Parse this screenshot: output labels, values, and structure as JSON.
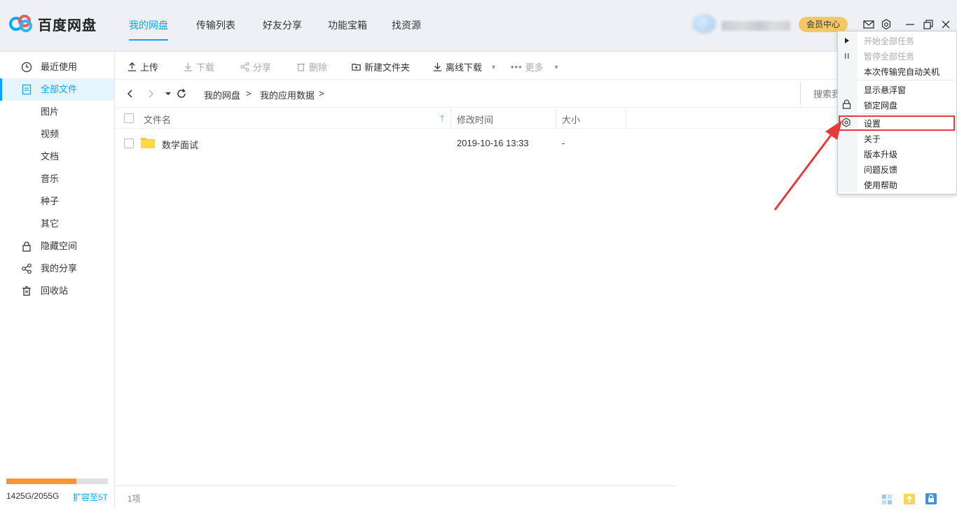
{
  "app": {
    "title": "百度网盘",
    "nav_tabs": [
      "我的网盘",
      "传输列表",
      "好友分享",
      "功能宝箱",
      "找资源"
    ],
    "active_tab": 0,
    "vip_label": "会员中心",
    "colors": {
      "accent": "#06a7ff",
      "vip": "#f5c867",
      "quota": "#f99637",
      "highlight": "#e53a3a"
    }
  },
  "sidebar": {
    "items": [
      {
        "label": "最近使用",
        "icon": "clock-icon"
      },
      {
        "label": "全部文件",
        "icon": "document-icon",
        "active": true
      },
      {
        "label": "图片"
      },
      {
        "label": "视频"
      },
      {
        "label": "文档"
      },
      {
        "label": "音乐"
      },
      {
        "label": "种子"
      },
      {
        "label": "其它"
      },
      {
        "label": "隐藏空间",
        "icon": "lock-icon"
      },
      {
        "label": "我的分享",
        "icon": "share-icon"
      },
      {
        "label": "回收站",
        "icon": "trash-icon"
      }
    ],
    "quota": {
      "text": "1425G/2055G",
      "used_fraction": 0.693,
      "expand_label": "扩容至5T"
    }
  },
  "toolbar": {
    "upload": "上传",
    "download": "下载",
    "share": "分享",
    "delete": "删除",
    "new_folder": "新建文件夹",
    "offline_download": "离线下载",
    "more": "更多"
  },
  "address": {
    "crumbs": [
      "我的网盘",
      "我的应用数据"
    ],
    "separator": ">",
    "search_placeholder": "搜索我"
  },
  "file_list": {
    "columns": {
      "name": "文件名",
      "modified": "修改时间",
      "size": "大小"
    },
    "rows": [
      {
        "name": "数学面试",
        "modified": "2019-10-16 13:33",
        "size": "-",
        "type": "folder"
      }
    ],
    "count_label": "1项"
  },
  "menu": {
    "items": [
      {
        "label": "开始全部任务",
        "disabled": true
      },
      {
        "label": "暂停全部任务",
        "disabled": true
      },
      {
        "label": "本次传输完自动关机"
      },
      {
        "label": "显示悬浮窗"
      },
      {
        "label": "锁定网盘"
      },
      {
        "label": "设置",
        "highlighted": true
      },
      {
        "label": "关于"
      },
      {
        "label": "版本升级"
      },
      {
        "label": "问题反馈"
      },
      {
        "label": "使用帮助"
      }
    ]
  }
}
